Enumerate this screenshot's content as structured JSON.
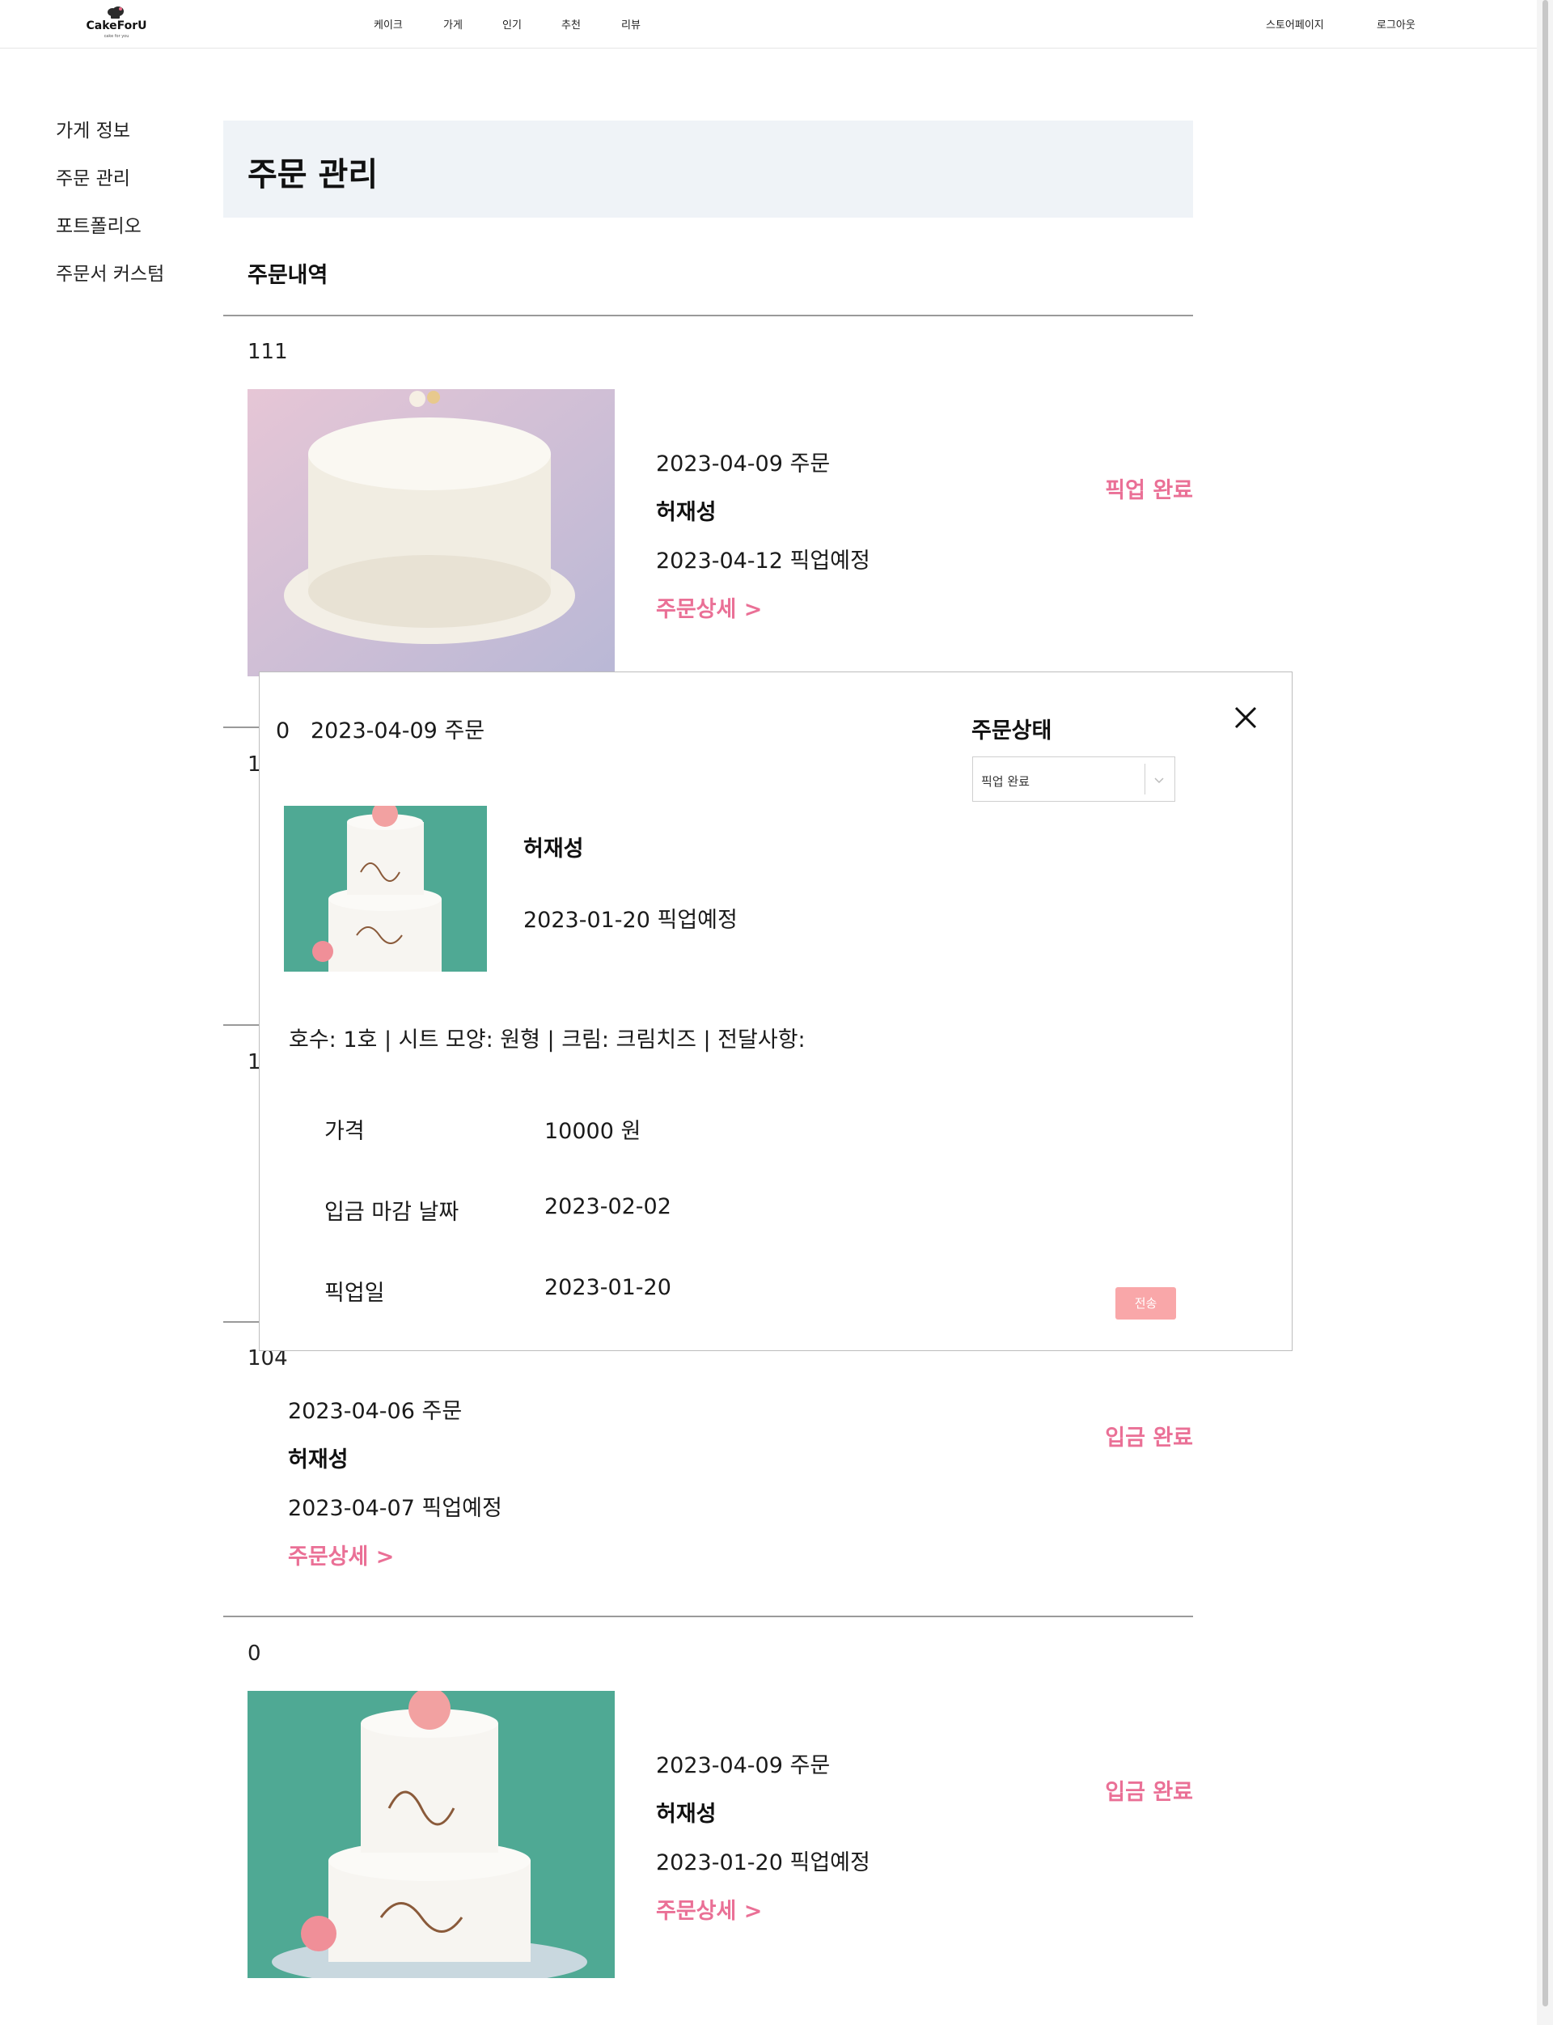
{
  "header": {
    "logo_text": "CakeForU",
    "logo_sub": "cake for you",
    "nav": [
      "케이크",
      "가게",
      "인기",
      "추천",
      "리뷰"
    ],
    "store_page": "스토어페이지",
    "logout": "로그아웃"
  },
  "sidebar": {
    "items": [
      "가게 정보",
      "주문 관리",
      "포트폴리오",
      "주문서 커스텀"
    ]
  },
  "main": {
    "title": "주문 관리",
    "section_title": "주문내역",
    "orders": [
      {
        "id": "111",
        "order_date": "2023-04-09 주문",
        "customer": "허재성",
        "pickup": "2023-04-12 픽업예정",
        "detail_link": "주문상세 >",
        "status": "픽업 완료"
      },
      {
        "id": "104",
        "order_date": "2023-04-06 주문",
        "customer": "허재성",
        "pickup": "2023-04-07 픽업예정",
        "detail_link": "주문상세 >",
        "status": "입금 완료"
      },
      {
        "id": "0",
        "order_date": "2023-04-09 주문",
        "customer": "허재성",
        "pickup": "2023-01-20 픽업예정",
        "detail_link": "주문상세 >",
        "status": "입금 완료"
      }
    ],
    "hidden_ids": [
      "1",
      "1"
    ]
  },
  "modal": {
    "order_id": "0",
    "order_date": "2023-04-09 주문",
    "status_label": "주문상태",
    "status_selected": "픽업 완료",
    "customer": "허재성",
    "pickup": "2023-01-20 픽업예정",
    "options": "호수: 1호 | 시트 모양: 원형 | 크림: 크림치즈 | 전달사항:",
    "rows": [
      {
        "label": "가격",
        "value": "10000 원"
      },
      {
        "label": "입금 마감 날짜",
        "value": "2023-02-02"
      },
      {
        "label": "픽업일",
        "value": "2023-01-20"
      }
    ],
    "send_label": "전송"
  },
  "colors": {
    "accent_pink": "#ea7096",
    "send_button": "#f9a7a9",
    "title_bg": "#eff3f7"
  },
  "icons": [
    "cake-logo-icon",
    "close-icon",
    "chevron-down-icon"
  ]
}
